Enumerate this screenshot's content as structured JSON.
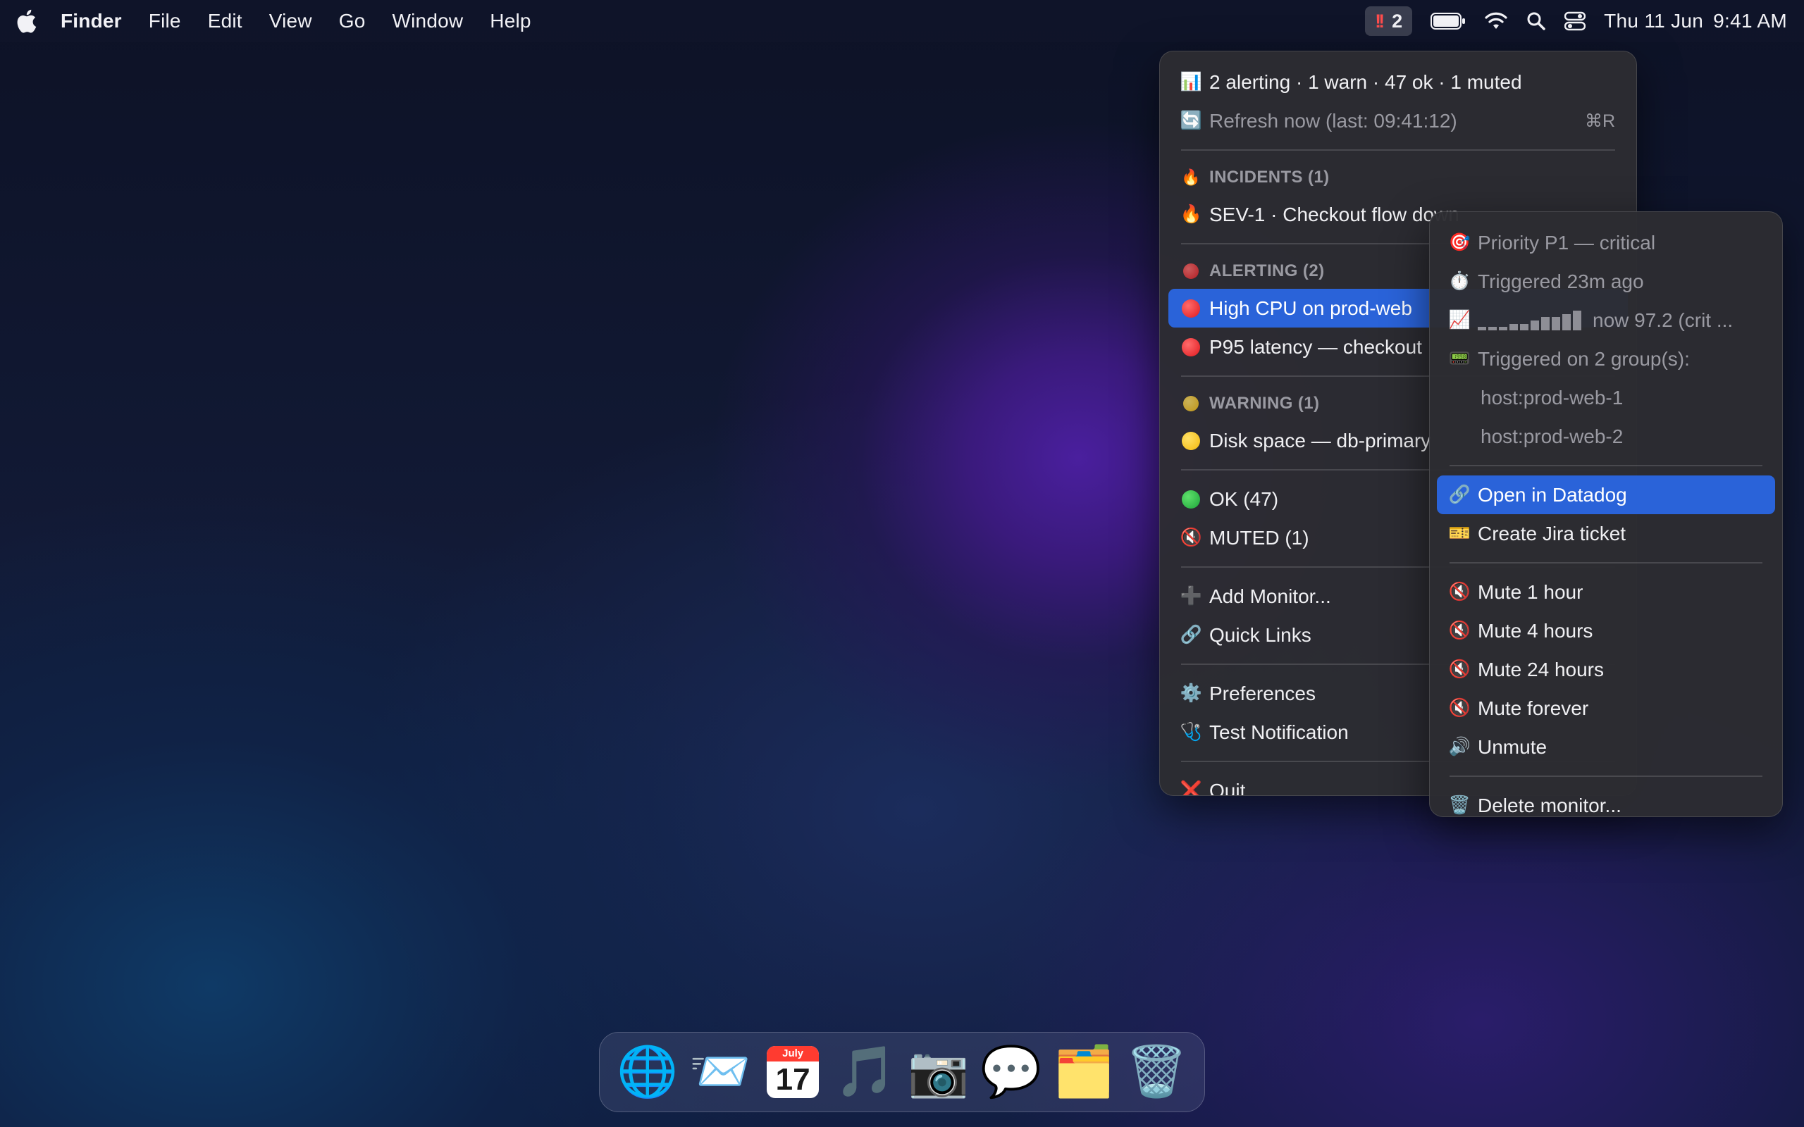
{
  "menubar": {
    "app_name": "Finder",
    "menus": [
      "File",
      "Edit",
      "View",
      "Go",
      "Window",
      "Help"
    ],
    "status_item": {
      "icon": "double-exclamation",
      "count": "2"
    },
    "clock": {
      "date": "Thu 11 Jun",
      "time": "9:41 AM"
    }
  },
  "main_menu": {
    "summary": "2 alerting · 1 warn · 47 ok · 1 muted",
    "refresh": {
      "label": "Refresh now (last: 09:41:12)",
      "shortcut": "⌘R"
    },
    "incidents": {
      "header": "INCIDENTS (1)",
      "items": [
        "SEV-1 · Checkout flow down"
      ]
    },
    "alerting": {
      "header": "ALERTING (2)",
      "items": [
        "High CPU on prod-web",
        "P95 latency — checkout"
      ]
    },
    "warning": {
      "header": "WARNING (1)",
      "items": [
        "Disk space — db-primary"
      ]
    },
    "ok": "OK (47)",
    "muted": "MUTED (1)",
    "add_monitor": "Add Monitor...",
    "quick_links": "Quick Links",
    "preferences": "Preferences",
    "test_notification": "Test Notification",
    "quit": "Quit"
  },
  "submenu": {
    "priority": "Priority P1 — critical",
    "triggered": "Triggered 23m ago",
    "sparkline": {
      "values": [
        1,
        1,
        1,
        2,
        2,
        3,
        4,
        4,
        5,
        6
      ],
      "now_label": "now 97.2 (crit ..."
    },
    "groups_label": "Triggered on 2 group(s):",
    "groups": [
      "host:prod-web-1",
      "host:prod-web-2"
    ],
    "open_datadog": "Open in Datadog",
    "create_jira": "Create Jira ticket",
    "mute_1h": "Mute 1 hour",
    "mute_4h": "Mute 4 hours",
    "mute_24h": "Mute 24 hours",
    "mute_forever": "Mute forever",
    "unmute": "Unmute",
    "delete": "Delete monitor..."
  },
  "dock": {
    "apps": [
      "Browser",
      "Mail",
      "Calendar",
      "Music",
      "Camera",
      "Messages",
      "Files",
      "Trash"
    ],
    "calendar": {
      "month": "July",
      "day": "17"
    }
  },
  "colors": {
    "selection": "#2a63d9",
    "menu_bg": "#2c2c32",
    "alert_red": "#e0181e",
    "warn_yellow": "#f2b90c",
    "ok_green": "#1ea53a"
  }
}
